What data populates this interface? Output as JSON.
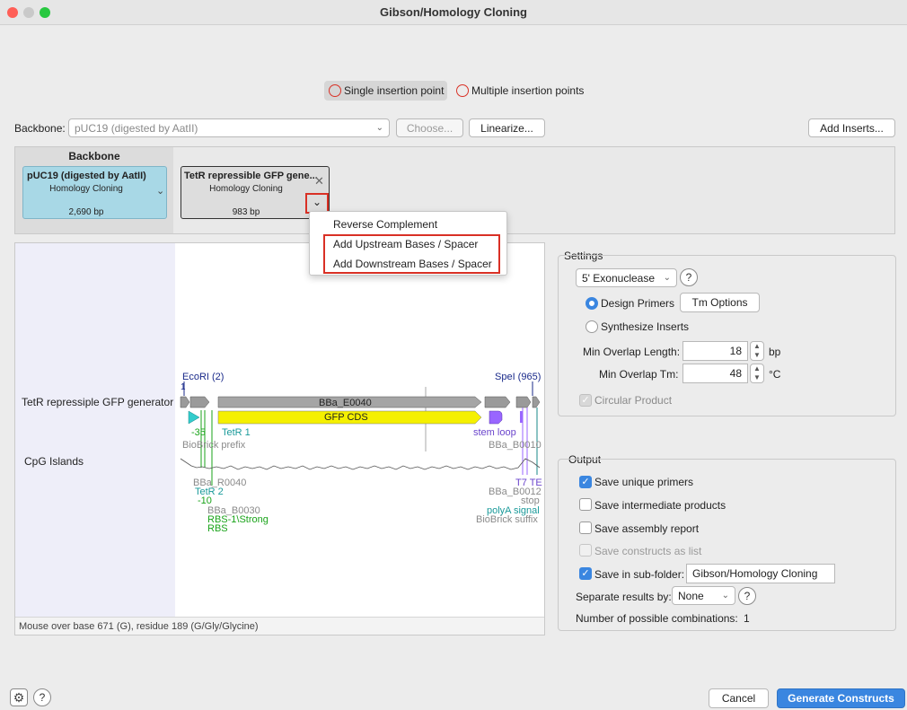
{
  "window": {
    "title": "Gibson/Homology Cloning"
  },
  "mode": {
    "single_label": "Single insertion point",
    "multiple_label": "Multiple insertion points"
  },
  "backbone_row": {
    "label": "Backbone:",
    "value": "pUC19 (digested by AatII)",
    "choose_label": "Choose...",
    "linearize_label": "Linearize...",
    "add_inserts_label": "Add Inserts..."
  },
  "fragments": {
    "backbone_header": "Backbone",
    "backbone_card": {
      "name": "pUC19 (digested by AatII)",
      "method": "Homology Cloning",
      "size": "2,690 bp"
    },
    "insert_card": {
      "name": "TetR repressible GFP gene...",
      "method": "Homology Cloning",
      "size": "983 bp"
    }
  },
  "context_menu": {
    "items": [
      "Reverse Complement",
      "Add Upstream Bases / Spacer",
      "Add Downstream Bases / Spacer"
    ]
  },
  "map": {
    "track_labels": [
      "TetR repressiple GFP generator",
      "CpG Islands"
    ],
    "site_labels": {
      "ecori": "EcoRI (2)",
      "spei": "SpeI (965)",
      "ecori_pos": "1"
    },
    "feature_labels": {
      "bba_e0040": "BBa_E0040",
      "gfp": "GFP CDS",
      "m35": "-35",
      "tetr1": "TetR 1",
      "biobrick_prefix": "BioBrick prefix",
      "stem_loop": "stem loop",
      "bba_b0010": "BBa_B0010",
      "bba_r0040": "BBa_R0040",
      "tetr2": "TetR 2",
      "m10": "-10",
      "bba_b0030": "BBa_B0030",
      "rbs": "RBS-1\\Strong",
      "rbs2": "RBS",
      "t7te": "T7 TE",
      "bba_b0012": "BBa_B0012",
      "stop": "stop",
      "polya": "polyA signal",
      "biobrick_suffix": "BioBrick suffix"
    },
    "status": "Mouse over base 671 (G), residue 189 (G/Gly/Glycine)"
  },
  "settings": {
    "title": "Settings",
    "method": "5' Exonuclease",
    "design_primers": "Design Primers",
    "tm_options": "Tm Options",
    "synthesize_inserts": "Synthesize Inserts",
    "min_overlap_length_label": "Min Overlap Length:",
    "min_overlap_length": "18",
    "bp": "bp",
    "min_overlap_tm_label": "Min Overlap Tm:",
    "min_overlap_tm": "48",
    "degc": "°C",
    "circular_product": "Circular Product"
  },
  "output": {
    "title": "Output",
    "save_unique_primers": "Save unique primers",
    "save_intermediate": "Save intermediate products",
    "save_assembly_report": "Save assembly report",
    "save_constructs_list": "Save constructs as list",
    "save_subfolder": "Save in sub-folder:",
    "subfolder_name": "Gibson/Homology Cloning",
    "separate_label": "Separate results by:",
    "separate_value": "None",
    "combinations_label": "Number of possible combinations:",
    "combinations_value": "1"
  },
  "footer": {
    "cancel": "Cancel",
    "generate": "Generate Constructs",
    "help": "?"
  },
  "colors": {
    "accent": "#3a86e0",
    "highlight": "#d93025",
    "gfp": "#f5f000",
    "backbone_card": "#a8d8e6"
  }
}
